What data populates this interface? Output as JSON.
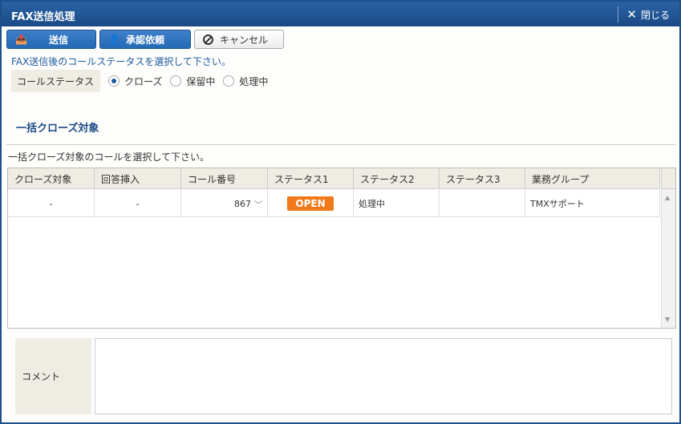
{
  "window": {
    "title": "FAX送信処理",
    "close_label": "閉じる"
  },
  "toolbar": {
    "send_label": "送信",
    "approve_label": "承認依頼",
    "cancel_label": "キャンセル"
  },
  "call_status": {
    "hint": "FAX送信後のコールステータスを選択して下さい。",
    "label": "コールステータス",
    "options": [
      {
        "label": "クローズ",
        "checked": true
      },
      {
        "label": "保留中",
        "checked": false
      },
      {
        "label": "処理中",
        "checked": false
      }
    ]
  },
  "bulk_close": {
    "title": "一括クローズ対象",
    "hint": "一括クローズ対象のコールを選択して下さい。",
    "columns": [
      "クローズ対象",
      "回答挿入",
      "コール番号",
      "ステータス1",
      "ステータス2",
      "ステータス3",
      "業務グループ"
    ],
    "rows": [
      {
        "close_target": "-",
        "answer_insert": "-",
        "call_number": "867",
        "status1": "OPEN",
        "status2": "処理中",
        "status3": "",
        "group": "TMXサポート"
      }
    ]
  },
  "comment": {
    "label": "コメント",
    "value": ""
  },
  "colors": {
    "title_bar": "#1b4a85",
    "accent": "#246ab5",
    "badge": "#f07a1a"
  },
  "icons": [
    "send-icon",
    "add-user-icon",
    "cancel-icon",
    "close-icon",
    "chevron-down-icon"
  ]
}
